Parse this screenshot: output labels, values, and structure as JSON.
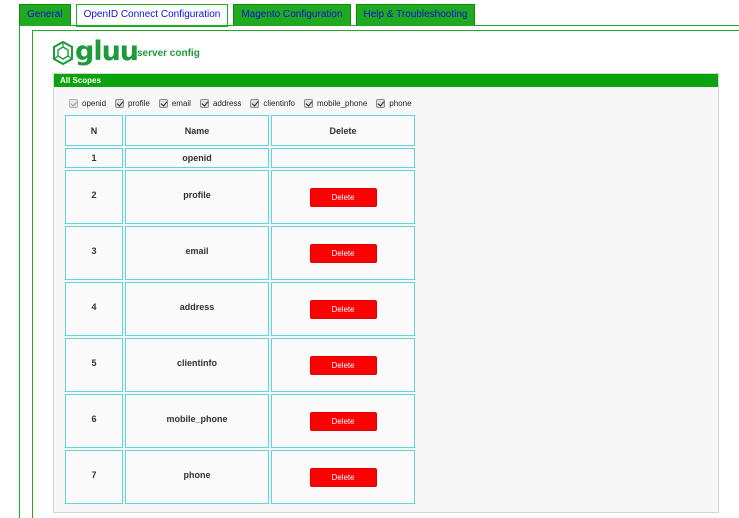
{
  "tabs": [
    {
      "label": "General"
    },
    {
      "label": "OpenID Connect Configuration",
      "active": true
    },
    {
      "label": "Magento Configuration"
    },
    {
      "label": "Help & Troubleshooting"
    }
  ],
  "brand": {
    "logo_text": "gluu",
    "subtitle": "server config"
  },
  "section": {
    "title": "All Scopes"
  },
  "scopes": [
    {
      "label": "openid",
      "checked": true,
      "disabled": true
    },
    {
      "label": "profile",
      "checked": true
    },
    {
      "label": "email",
      "checked": true
    },
    {
      "label": "address",
      "checked": true
    },
    {
      "label": "clientinfo",
      "checked": true
    },
    {
      "label": "mobile_phone",
      "checked": true
    },
    {
      "label": "phone",
      "checked": true
    }
  ],
  "table": {
    "headers": {
      "n": "N",
      "name": "Name",
      "delete": "Delete"
    },
    "delete_label": "Delete",
    "rows": [
      {
        "n": "1",
        "name": "openid",
        "deletable": false
      },
      {
        "n": "2",
        "name": "profile",
        "deletable": true
      },
      {
        "n": "3",
        "name": "email",
        "deletable": true
      },
      {
        "n": "4",
        "name": "address",
        "deletable": true
      },
      {
        "n": "5",
        "name": "clientinfo",
        "deletable": true
      },
      {
        "n": "6",
        "name": "mobile_phone",
        "deletable": true
      },
      {
        "n": "7",
        "name": "phone",
        "deletable": true
      }
    ]
  },
  "colors": {
    "accent": "#1faa1f",
    "header": "#0ba30b",
    "delete": "#ff0000",
    "grid": "#5cd6dc",
    "link": "#0b12d6"
  }
}
